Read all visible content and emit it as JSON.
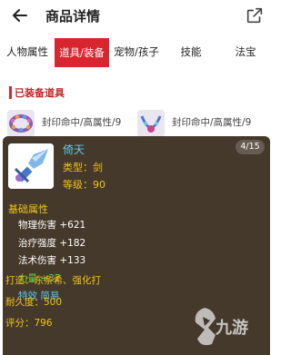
{
  "header": {
    "title": "商品详情",
    "back_icon": "back-arrow-icon",
    "share_icon": "share-icon"
  },
  "tabs": [
    {
      "label": "人物属性"
    },
    {
      "label": "道具/装备"
    },
    {
      "label": "宠物/孩子"
    },
    {
      "label": "技能"
    },
    {
      "label": "法宝"
    }
  ],
  "equipped": {
    "title": "已装备道具",
    "items": [
      {
        "text": "封印命中/高属性/9"
      },
      {
        "text": "封印命中/高属性/9"
      }
    ]
  },
  "tooltip": {
    "name": "倚天",
    "type": "类型：剑",
    "level": "等级：90",
    "page": "4/15",
    "attr_title": "基础属性",
    "attributes": [
      {
        "text": "物理伤害 +621"
      },
      {
        "text": "治疗强度 +182"
      },
      {
        "text": "法术伤害 +133"
      },
      {
        "text": "力量 +37"
      },
      {
        "text": "特效 简易"
      }
    ],
    "forge": "打造：东条希、强化打",
    "durability": "耐久度：500",
    "score": "评分：796"
  },
  "watermark": {
    "text": "九游"
  },
  "colors": {
    "accent": "#d9252e",
    "tooltip_bg": "#372a1c",
    "gold": "#f0c419",
    "cyan": "#5ecbe6",
    "green": "#6fd03f"
  }
}
